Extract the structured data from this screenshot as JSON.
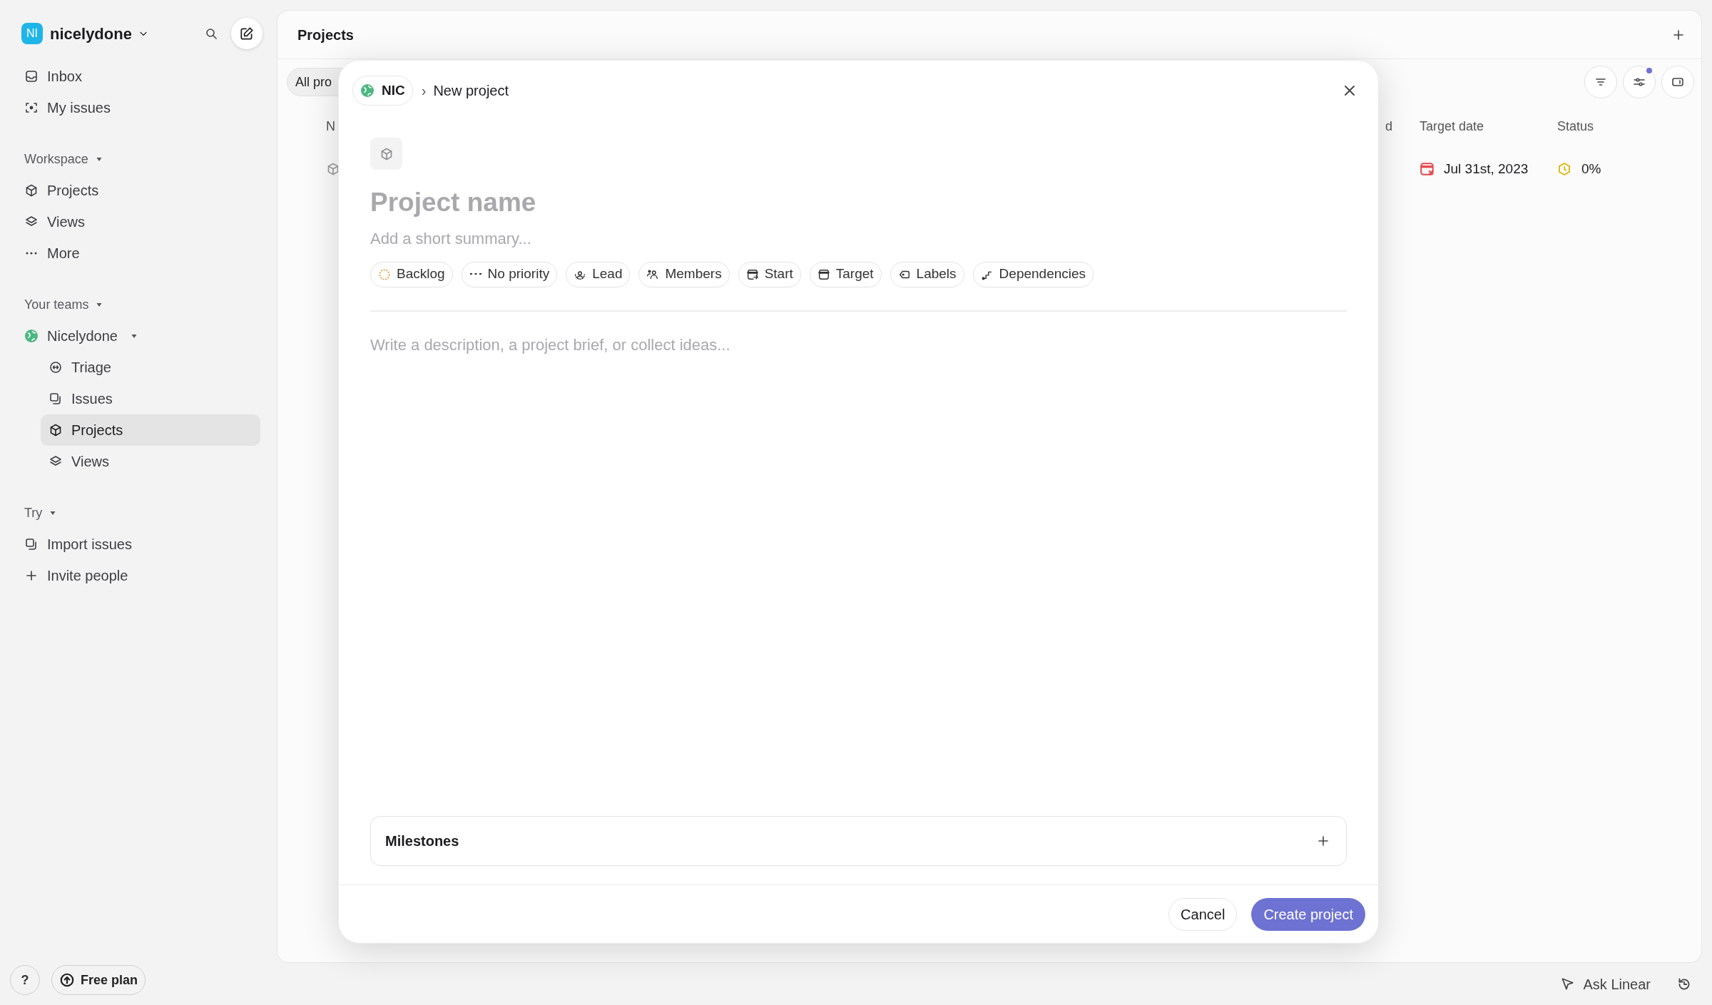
{
  "sidebar": {
    "workspace": {
      "avatar": "NI",
      "name": "nicelydone"
    },
    "nav": [
      {
        "label": "Inbox",
        "selected": false
      },
      {
        "label": "My issues",
        "selected": false
      }
    ],
    "sections": [
      {
        "title": "Workspace",
        "items": [
          {
            "label": "Projects",
            "selected": false
          },
          {
            "label": "Views",
            "selected": false
          },
          {
            "label": "More",
            "selected": false
          }
        ]
      },
      {
        "title": "Your teams",
        "items": [
          {
            "label": "Nicelydone",
            "selected": false,
            "expanded": true,
            "children": [
              {
                "label": "Triage",
                "selected": false
              },
              {
                "label": "Issues",
                "selected": false
              },
              {
                "label": "Projects",
                "selected": true
              },
              {
                "label": "Views",
                "selected": false
              }
            ]
          }
        ]
      },
      {
        "title": "Try",
        "items": [
          {
            "label": "Import issues",
            "selected": false
          },
          {
            "label": "Invite people",
            "selected": false
          }
        ]
      }
    ],
    "footer": {
      "help": "?",
      "plan": "Free plan"
    }
  },
  "main": {
    "title": "Projects",
    "filter_chip": "All pro",
    "columns": [
      "N",
      "d",
      "Target date",
      "Status"
    ],
    "rows": [
      {
        "target_date": "Jul 31st, 2023",
        "status": "0%"
      }
    ]
  },
  "modal": {
    "team": "NIC",
    "separator": "›",
    "title": "New project",
    "name_placeholder": "Project name",
    "summary_placeholder": "Add a short summary...",
    "properties": [
      {
        "label": "Backlog"
      },
      {
        "label": "No priority"
      },
      {
        "label": "Lead"
      },
      {
        "label": "Members"
      },
      {
        "label": "Start"
      },
      {
        "label": "Target"
      },
      {
        "label": "Labels"
      },
      {
        "label": "Dependencies"
      }
    ],
    "description_placeholder": "Write a description, a project brief, or collect ideas...",
    "milestones": "Milestones",
    "buttons": {
      "cancel": "Cancel",
      "create": "Create project"
    }
  },
  "bottom_bar": {
    "ask": "Ask Linear"
  }
}
